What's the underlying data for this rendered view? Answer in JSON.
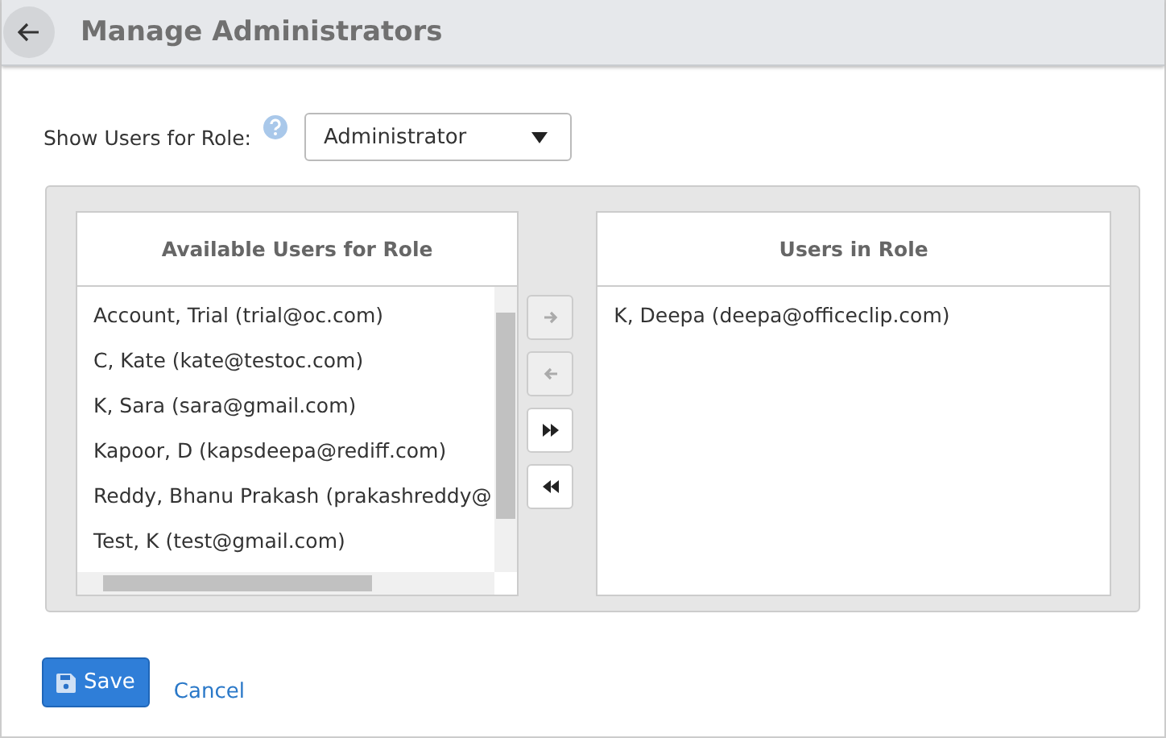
{
  "header": {
    "title": "Manage Administrators"
  },
  "role_filter": {
    "label": "Show Users for Role:",
    "value": "Administrator"
  },
  "available_list": {
    "title": "Available Users for Role",
    "items": [
      {
        "label": "Account, Trial (trial@oc.com)",
        "selected": false
      },
      {
        "label": "C, Kate (kate@testoc.com)",
        "selected": false
      },
      {
        "label": "K, Sara (sara@gmail.com)",
        "selected": false
      },
      {
        "label": "Kapoor, D (kapsdeepa@rediff.com)",
        "selected": false
      },
      {
        "label": "Reddy, Bhanu Prakash (prakashreddy@",
        "selected": false
      },
      {
        "label": "Test, K (test@gmail.com)",
        "selected": false
      }
    ]
  },
  "move_buttons": [
    {
      "kind": "right",
      "disabled": true
    },
    {
      "kind": "left",
      "disabled": true
    },
    {
      "kind": "all-right",
      "disabled": false
    },
    {
      "kind": "all-left",
      "disabled": false
    }
  ],
  "role_list": {
    "title": "Users in Role",
    "items": [
      {
        "label": "K, Deepa (deepa@officeclip.com)",
        "selected": false
      }
    ]
  },
  "actions": {
    "save": "Save",
    "cancel": "Cancel"
  }
}
